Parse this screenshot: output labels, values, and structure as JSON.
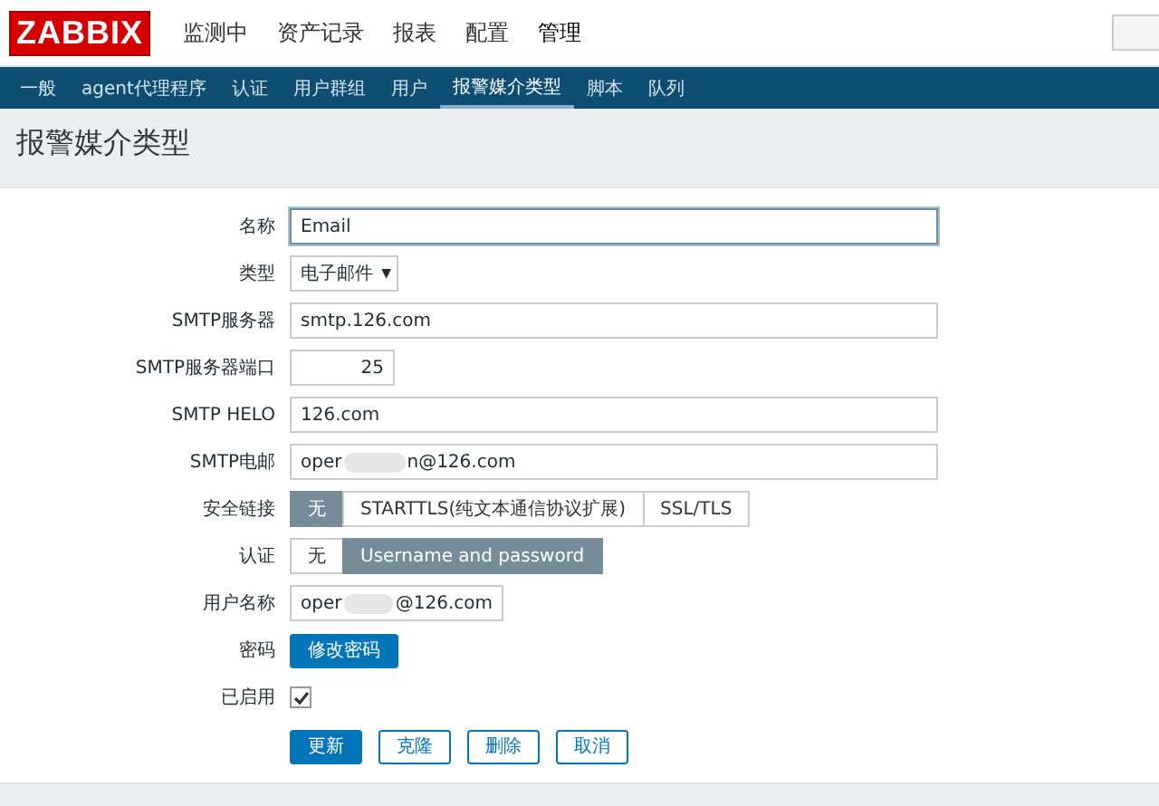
{
  "logo": "ZABBIX",
  "main_menu": [
    {
      "label": "监测中",
      "selected": false
    },
    {
      "label": "资产记录",
      "selected": false
    },
    {
      "label": "报表",
      "selected": false
    },
    {
      "label": "配置",
      "selected": false
    },
    {
      "label": "管理",
      "selected": true
    }
  ],
  "sub_menu": [
    {
      "label": "一般",
      "selected": false
    },
    {
      "label": "agent代理程序",
      "selected": false
    },
    {
      "label": "认证",
      "selected": false
    },
    {
      "label": "用户群组",
      "selected": false
    },
    {
      "label": "用户",
      "selected": false
    },
    {
      "label": "报警媒介类型",
      "selected": true
    },
    {
      "label": "脚本",
      "selected": false
    },
    {
      "label": "队列",
      "selected": false
    }
  ],
  "page_title": "报警媒介类型",
  "form": [
    {
      "kind": "text",
      "label": "名称",
      "value": "Email",
      "focused": true
    },
    {
      "kind": "select",
      "label": "类型",
      "value": "电子邮件",
      "arrow": "▼"
    },
    {
      "kind": "text",
      "label": "SMTP服务器",
      "value": "smtp.126.com",
      "focused": false
    },
    {
      "kind": "number",
      "label": "SMTP服务器端口",
      "value": "25"
    },
    {
      "kind": "text",
      "label": "SMTP HELO",
      "value": "126.com",
      "focused": false
    },
    {
      "kind": "blurred",
      "label": "SMTP电邮",
      "value_start": "oper",
      "value_end": "n@126.com",
      "wide": true
    },
    {
      "kind": "segmented",
      "label": "安全链接",
      "options": [
        {
          "label": "无",
          "selected": true
        },
        {
          "label": "STARTTLS(纯文本通信协议扩展)",
          "selected": false
        },
        {
          "label": "SSL/TLS",
          "selected": false
        }
      ]
    },
    {
      "kind": "segmented",
      "label": "认证",
      "options": [
        {
          "label": "无",
          "selected": false
        },
        {
          "label": "Username and password",
          "selected": true
        }
      ]
    },
    {
      "kind": "blurred",
      "label": "用户名称",
      "value_start": "oper",
      "value_end": "@126.com",
      "wide": false
    },
    {
      "kind": "button",
      "label": "密码",
      "button": "修改密码"
    },
    {
      "kind": "checkbox",
      "label": "已启用",
      "checked": true
    }
  ],
  "actions": [
    {
      "label": "更新",
      "primary": true
    },
    {
      "label": "克隆",
      "primary": false
    },
    {
      "label": "删除",
      "primary": false
    },
    {
      "label": "取消",
      "primary": false
    }
  ]
}
